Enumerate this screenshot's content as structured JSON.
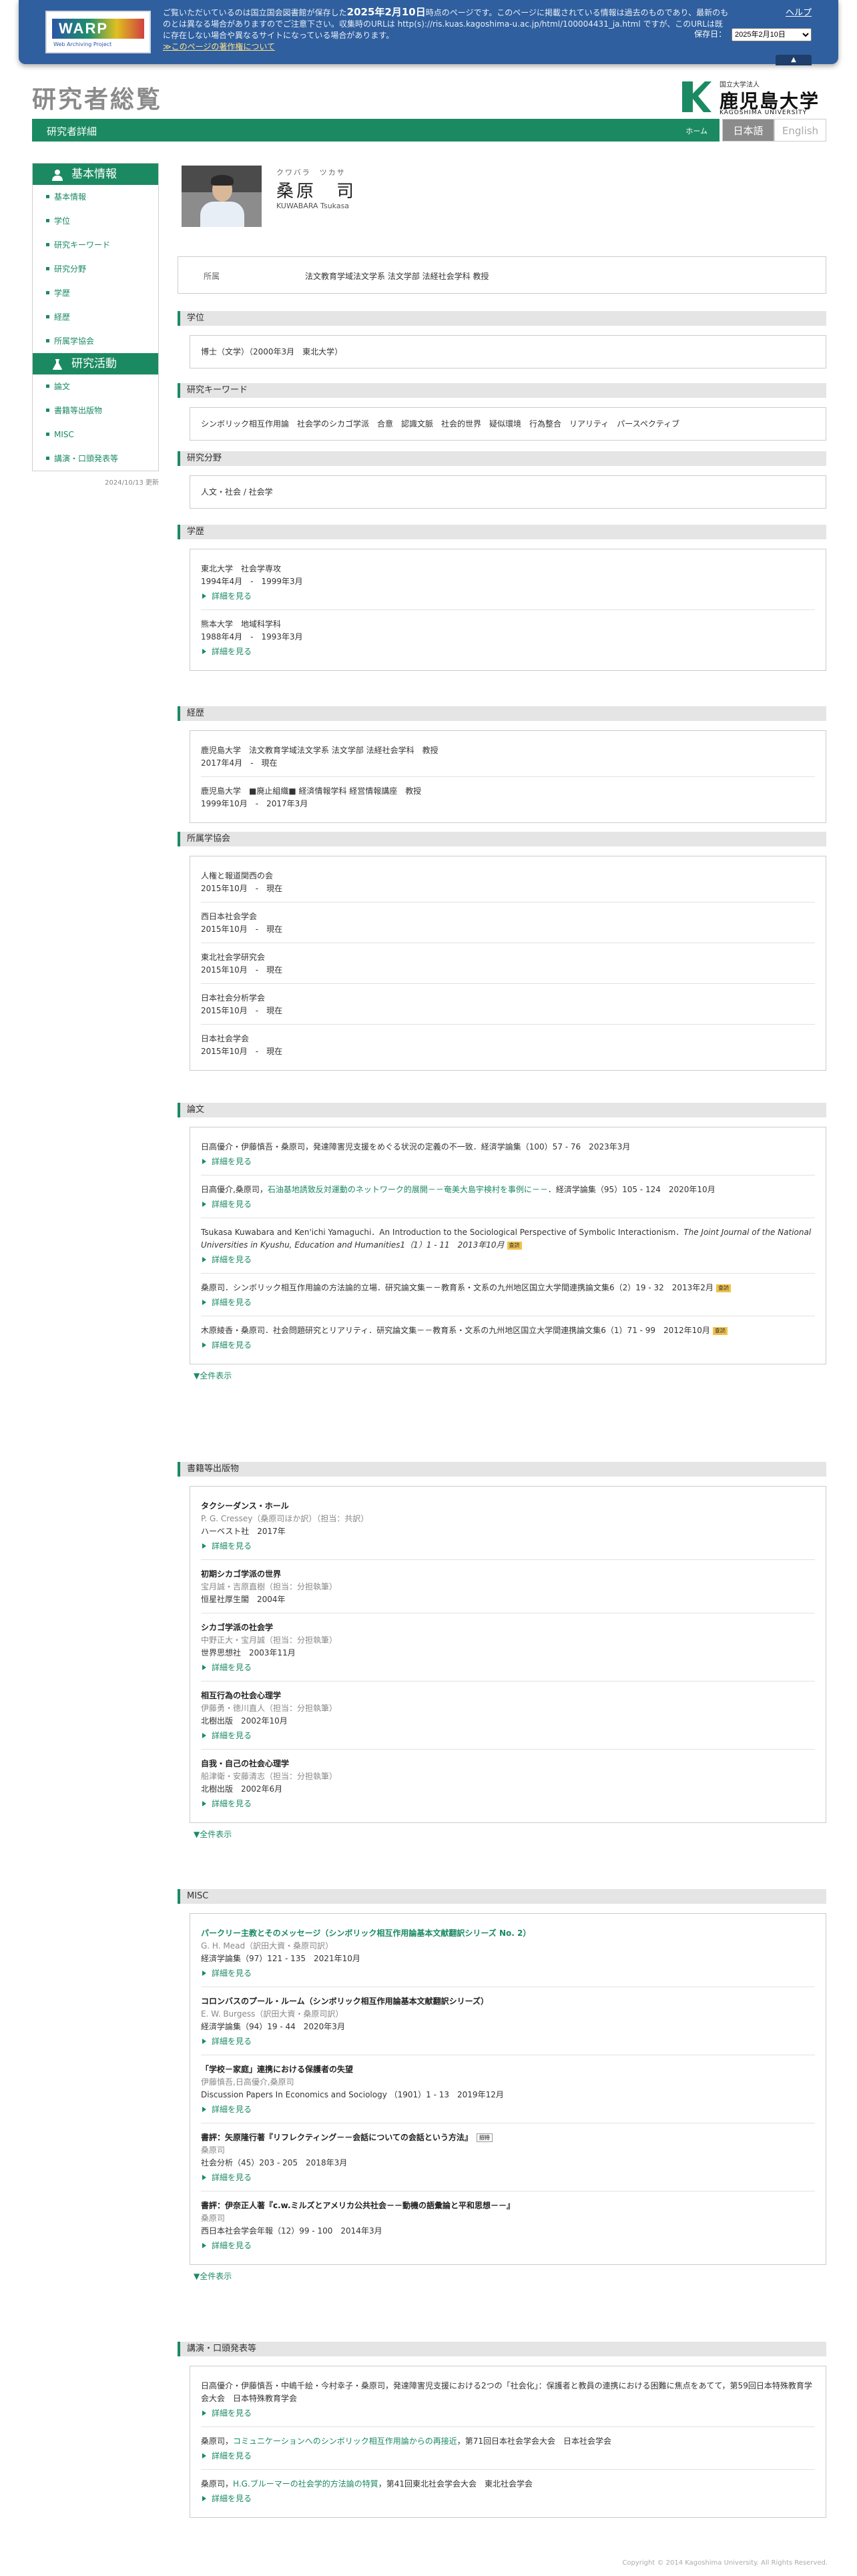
{
  "warp": {
    "logo_word": "WARP",
    "logo_sub": "Web Archiving Project",
    "text_pre": "ご覧いただいているのは国立国会図書館が保存した",
    "text_date": "2025年2月10日",
    "text_post": "時点のページです。このページに掲載されている情報は過去のものであり、最新のものとは異なる場合がありますのでご注意下さい。収集時のURLは http(s)://ris.kuas.kagoshima-u.ac.jp/html/100004431_ja.html ですが、このURLは既に存在しない場合や異なるサイトになっている場合があります。",
    "link": "≫このページの著作権について",
    "help": "ヘルプ",
    "date_label": "保存日：",
    "date_value": "2025年2月10日",
    "up": "▲"
  },
  "header": {
    "site_title": "研究者総覧",
    "uni_small": "国立大学法人",
    "uni_name": "鹿児島大学",
    "uni_en": "KAGOSHIMA UNIVERSITY",
    "page_title": "研究者詳細",
    "home": "ホーム",
    "lang_ja": "日本語",
    "lang_en": "English"
  },
  "sidebar": {
    "basic_title": "基本情報",
    "basic_items": [
      "基本情報",
      "学位",
      "研究キーワード",
      "研究分野",
      "学歴",
      "経歴",
      "所属学協会"
    ],
    "research_title": "研究活動",
    "research_items": [
      "論文",
      "書籍等出版物",
      "MISC",
      "講演・口頭発表等"
    ],
    "updated": "2024/10/13 更新"
  },
  "profile": {
    "kana": "クワバラ　ツカサ",
    "name": "桑原　司",
    "name_en": "KUWABARA Tsukasa",
    "aff_label": "所属",
    "aff_value": "法文教育学域法文学系 法文学部 法経社会学科 教授"
  },
  "degree": {
    "title": "学位",
    "value": "博士（文学）（2000年3月　東北大学）"
  },
  "keywords": {
    "title": "研究キーワード",
    "value": "シンボリック相互作用論　社会学のシカゴ学派　合意　認識文脈　社会的世界　疑似環境　行為整合　リアリティ　パースペクティブ"
  },
  "field": {
    "title": "研究分野",
    "value": "人文・社会 / 社会学"
  },
  "more": "詳細を見る",
  "showall": "▼全件表示",
  "education": {
    "title": "学歴",
    "items": [
      {
        "name": "東北大学　社会学専攻",
        "period": "1994年4月　-　1999年3月"
      },
      {
        "name": "熊本大学　地域科学科",
        "period": "1988年4月　-　1993年3月"
      }
    ]
  },
  "career": {
    "title": "経歴",
    "items": [
      {
        "name": "鹿児島大学　法文教育学域法文学系 法文学部 法経社会学科　教授",
        "period": "2017年4月　-　現在"
      },
      {
        "name": "鹿児島大学　■廃止組織■ 経済情報学科 経営情報講座　教授",
        "period": "1999年10月　-　2017年3月"
      }
    ]
  },
  "societies": {
    "title": "所属学協会",
    "items": [
      {
        "name": "人権と報道関西の会",
        "period": "2015年10月　-　現在"
      },
      {
        "name": "西日本社会学会",
        "period": "2015年10月　-　現在"
      },
      {
        "name": "東北社会学研究会",
        "period": "2015年10月　-　現在"
      },
      {
        "name": "日本社会分析学会",
        "period": "2015年10月　-　現在"
      },
      {
        "name": "日本社会学会",
        "period": "2015年10月　-　現在"
      }
    ]
  },
  "papers": {
    "title": "論文",
    "items": [
      {
        "pre": "日高優介・伊藤慎吾・桑原司，",
        "link": "",
        "post": "発達障害児支援をめぐる状況の定義の不一致．経済学論集（100）57 - 76　2023年3月",
        "badge": ""
      },
      {
        "pre": "日高優介,桑原司，",
        "link": "石油基地誘致反対運動のネットワーク的展開－－奄美大島宇検村を事例に－－",
        "post": "．経済学論集（95）105 - 124　2020年10月",
        "badge": ""
      },
      {
        "pre": "Tsukasa Kuwabara and Ken'ichi Yamaguchi．An Introduction to the Sociological Perspective of Symbolic Interactionism．",
        "link": "",
        "post": "The Joint Journal of the National Universities in Kyushu, Education and Humanities1（1）1 - 11　2013年10月",
        "badge": "査読"
      },
      {
        "pre": "桑原司．シンボリック相互作用論の方法論的立場．研究論文集－－教育系・文系の九州地区国立大学間連携論文集6（2）19 - 32　2013年2月",
        "link": "",
        "post": "",
        "badge": "査読"
      },
      {
        "pre": "木原綾香・桑原司．社会問題研究とリアリティ．研究論文集－－教育系・文系の九州地区国立大学間連携論文集6（1）71 - 99　2012年10月",
        "link": "",
        "post": "",
        "badge": "査読"
      }
    ]
  },
  "books": {
    "title": "書籍等出版物",
    "items": [
      {
        "title": "タクシーダンス・ホール",
        "authors": "P. G. Cressey（桑原司ほか訳）（担当：共訳）",
        "pub": "ハーベスト社　2017年"
      },
      {
        "title": "初期シカゴ学派の世界",
        "authors": "宝月誠・吉原直樹（担当：分担執筆）",
        "pub": "恒星社厚生閣　2004年"
      },
      {
        "title": "シカゴ学派の社会学",
        "authors": "中野正大・宝月誠（担当：分担執筆）",
        "pub": "世界思想社　2003年11月"
      },
      {
        "title": "相互行為の社会心理学",
        "authors": "伊藤勇・徳川直人（担当：分担執筆）",
        "pub": "北樹出版　2002年10月"
      },
      {
        "title": "自我・自己の社会心理学",
        "authors": "船津衛・安藤清志（担当：分担執筆）",
        "pub": "北樹出版　2002年6月"
      }
    ]
  },
  "misc": {
    "title": "MISC",
    "items": [
      {
        "title": "パークリー主教とそのメッセージ（シンボリック相互作用論基本文献翻訳シリーズ No. 2）",
        "title_link": true,
        "authors": "G. H. Mead（訳田大資・桑原司訳）",
        "pub": "経済学論集（97）121 - 135　2021年10月",
        "badge": ""
      },
      {
        "title": "コロンバスのプール・ルーム（シンボリック相互作用論基本文献翻訳シリーズ）",
        "title_link": false,
        "authors": "E. W. Burgess（訳田大資・桑原司訳）",
        "pub": "経済学論集（94）19 - 44　2020年3月",
        "badge": ""
      },
      {
        "title": "「学校－家庭」連携における保護者の失望",
        "title_link": false,
        "authors": "伊藤慎吾,日高優介,桑原司",
        "pub": "Discussion Papers In Economics and Sociology （1901）1 - 13　2019年12月",
        "badge": ""
      },
      {
        "title": "書評：矢原隆行著『リフレクティング－－会話についての会話という方法』",
        "title_link": false,
        "authors": "桑原司",
        "pub": "社会分析（45）203 - 205　2018年3月",
        "badge": "招待"
      },
      {
        "title": "書評：伊奈正人著『c.w.ミルズとアメリカ公共社会－－動機の語彙論と平和思想－－』",
        "title_link": false,
        "authors": "桑原司",
        "pub": "西日本社会学会年報（12）99 - 100　2014年3月",
        "badge": ""
      }
    ]
  },
  "talks": {
    "title": "講演・口頭発表等",
    "items": [
      {
        "pre": "日高優介・伊藤慎吾・中嶋千絵・今村幸子・桑原司，発達障害児支援における2つの「社会化」：保護者と教員の連携における困難に焦点をあてて，第59回日本特殊教育学会大会　日本特殊教育学会",
        "link": "",
        "post": ""
      },
      {
        "pre": "桑原司，",
        "link": "コミュニケーションへのシンボリック相互作用論からの再接近",
        "post": "，第71回日本社会学会大会　日本社会学会"
      },
      {
        "pre": "桑原司，",
        "link": "H.G.ブルーマーの社会学的方法論の特質",
        "post": "，第41回東北社会学会大会　東北社会学会"
      }
    ]
  },
  "footer": "Copyright © 2014 Kagoshima University. All Rights Reserved."
}
